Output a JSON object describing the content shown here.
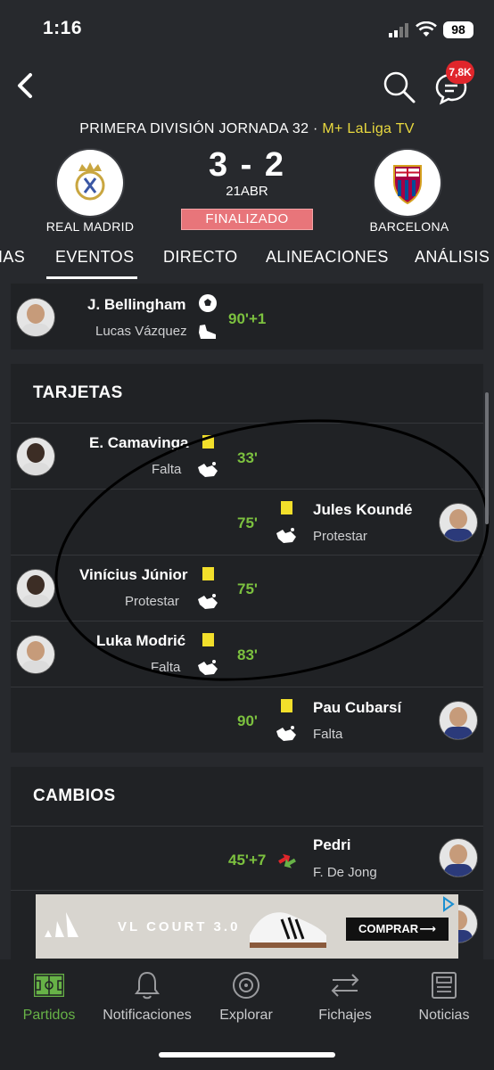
{
  "status_bar": {
    "time": "1:16",
    "battery": "98"
  },
  "header": {
    "notifications_badge": "7,8K",
    "competition": "PRIMERA DIVISIÓN JORNADA 32 · ",
    "broadcaster": "M+ LaLiga TV"
  },
  "match": {
    "home_team": "REAL MADRID",
    "away_team": "BARCELONA",
    "score": "3 - 2",
    "date": "21ABR",
    "status": "FINALIZADO"
  },
  "tabs": [
    "IAS",
    "EVENTOS",
    "DIRECTO",
    "ALINEACIONES",
    "ANÁLISIS"
  ],
  "goal_event": {
    "scorer": "J. Bellingham",
    "assist": "Lucas Vázquez",
    "minute": "90'+1"
  },
  "cards_section": {
    "title": "TARJETAS",
    "events": [
      {
        "player": "E. Camavinga",
        "reason": "Falta",
        "minute": "33'",
        "side": "home"
      },
      {
        "player": "Jules Koundé",
        "reason": "Protestar",
        "minute": "75'",
        "side": "away"
      },
      {
        "player": "Vinícius Júnior",
        "reason": "Protestar",
        "minute": "75'",
        "side": "home"
      },
      {
        "player": "Luka Modrić",
        "reason": "Falta",
        "minute": "83'",
        "side": "home"
      },
      {
        "player": "Pau Cubarsí",
        "reason": "Falta",
        "minute": "90'",
        "side": "away"
      }
    ]
  },
  "subs_section": {
    "title": "CAMBIOS",
    "events": [
      {
        "player_in": "Pedri",
        "player_out": "F. De Jong",
        "minute": "45'+7",
        "side": "away"
      }
    ]
  },
  "ad": {
    "text": "VL COURT 3.0",
    "cta": "COMPRAR"
  },
  "bottom_nav": [
    "Partidos",
    "Notificaciones",
    "Explorar",
    "Fichajes",
    "Noticias"
  ],
  "colors": {
    "background": "#27292d",
    "card": "#202225",
    "accent_green": "#7cc13f",
    "yellow_card": "#f2df2b",
    "status_red": "#e8757a"
  }
}
